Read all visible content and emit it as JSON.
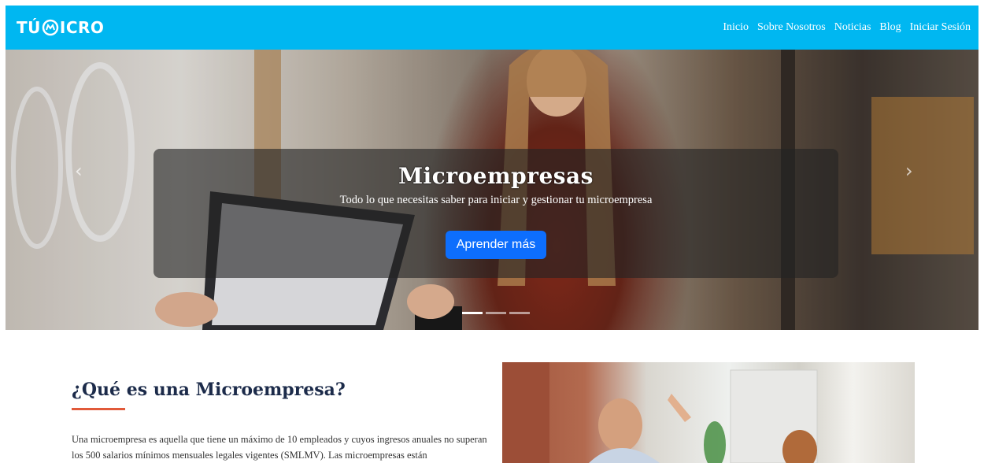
{
  "header": {
    "logo_left": "TÚ",
    "logo_right": "ICRO",
    "brand_color": "#00b7f1",
    "nav": [
      "Inicio",
      "Sobre Nosotros",
      "Noticias",
      "Blog",
      "Iniciar Sesión"
    ]
  },
  "hero": {
    "title": "Microempresas",
    "subtitle": "Todo lo que necesitas saber para iniciar y gestionar tu microempresa",
    "button_label": "Aprender más",
    "prev_icon": "chevron-left-icon",
    "next_icon": "chevron-right-icon",
    "slide_count": 3,
    "active_slide": 1
  },
  "about": {
    "title": "¿Qué es una Microempresa?",
    "accent_color": "#e15a3a",
    "text": "Una microempresa es aquella que tiene un máximo de 10 empleados y cuyos ingresos anuales no superan los 500 salarios mínimos mensuales legales vigentes (SMLMV). Las microempresas están"
  }
}
